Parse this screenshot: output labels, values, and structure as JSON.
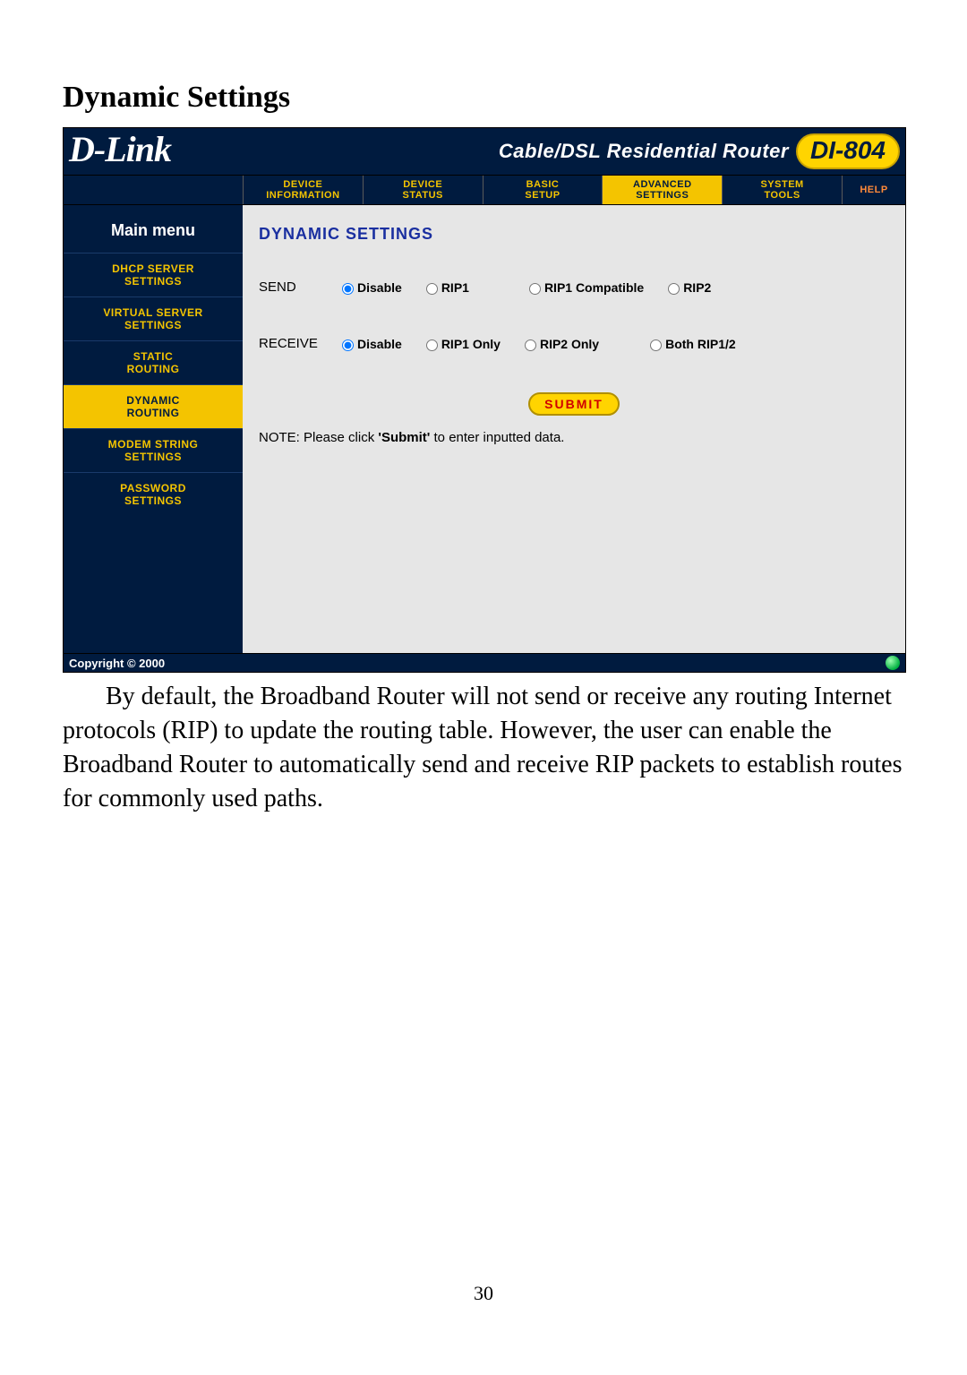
{
  "page_heading": "Dynamic Settings",
  "header": {
    "logo_text": "D-Link",
    "title": "Cable/DSL Residential Router",
    "model": "DI-804"
  },
  "topnav": [
    {
      "line1": "DEVICE",
      "line2": "INFORMATION",
      "active": false
    },
    {
      "line1": "DEVICE",
      "line2": "STATUS",
      "active": false
    },
    {
      "line1": "BASIC",
      "line2": "SETUP",
      "active": false
    },
    {
      "line1": "ADVANCED",
      "line2": "SETTINGS",
      "active": true
    },
    {
      "line1": "SYSTEM",
      "line2": "TOOLS",
      "active": false
    }
  ],
  "topnav_help": "HELP",
  "sidebar": {
    "title": "Main menu",
    "items": [
      {
        "line1": "DHCP SERVER",
        "line2": "SETTINGS",
        "active": false
      },
      {
        "line1": "VIRTUAL SERVER",
        "line2": "SETTINGS",
        "active": false
      },
      {
        "line1": "STATIC",
        "line2": "ROUTING",
        "active": false
      },
      {
        "line1": "DYNAMIC",
        "line2": "ROUTING",
        "active": true
      },
      {
        "line1": "MODEM STRING",
        "line2": "SETTINGS",
        "active": false
      },
      {
        "line1": "PASSWORD",
        "line2": "SETTINGS",
        "active": false
      }
    ]
  },
  "panel": {
    "title": "DYNAMIC SETTINGS",
    "send": {
      "label": "SEND",
      "options": [
        "Disable",
        "RIP1",
        "RIP1 Compatible",
        "RIP2"
      ],
      "selected": "Disable"
    },
    "receive": {
      "label": "RECEIVE",
      "options": [
        "Disable",
        "RIP1 Only",
        "RIP2 Only",
        "Both RIP1/2"
      ],
      "selected": "Disable"
    },
    "submit_label": "SUBMIT",
    "note_prefix": "NOTE: Please click ",
    "note_bold": "'Submit'",
    "note_suffix": " to enter inputted data."
  },
  "footer": {
    "copyright": "Copyright © 2000"
  },
  "doc_paragraph": "By default, the Broadband Router will not send or receive any routing Internet protocols (RIP) to update the routing table.  However, the user can enable the Broadband Router to automatically send and receive RIP packets to establish routes for commonly used paths.",
  "page_number": "30"
}
